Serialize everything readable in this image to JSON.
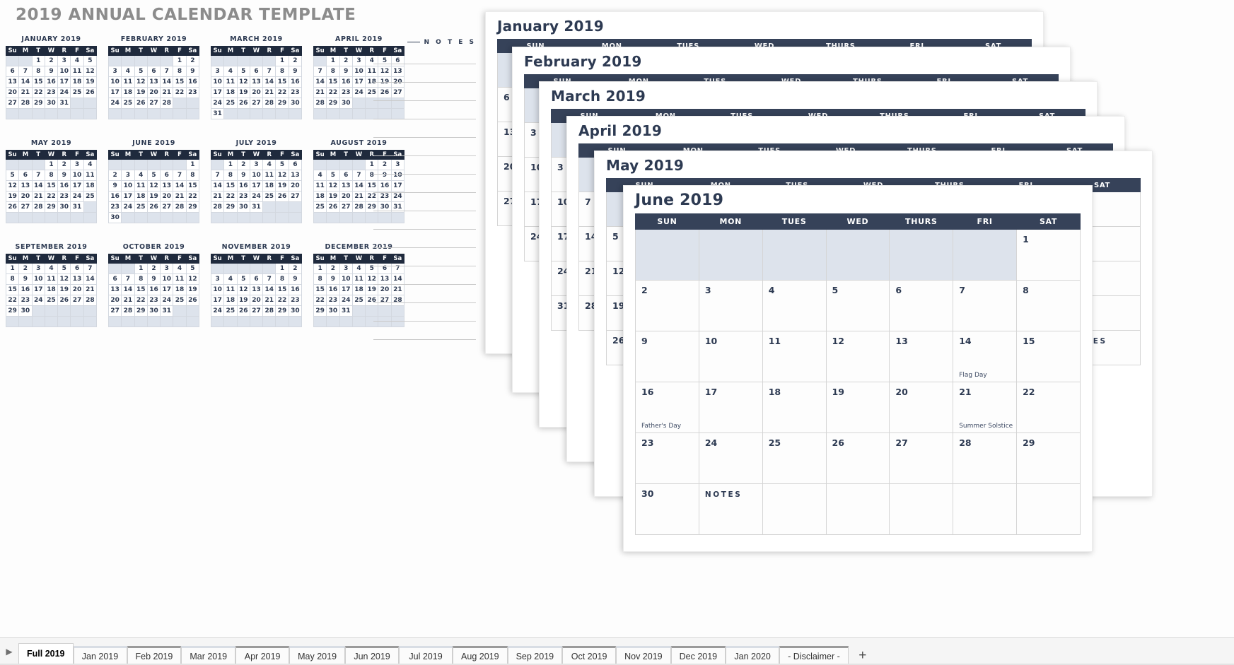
{
  "page_title": "2019 ANNUAL CALENDAR TEMPLATE",
  "notes_left": {
    "heading": "N O T E S",
    "line_count": 16
  },
  "mini_weekday_headers": [
    "Su",
    "M",
    "T",
    "W",
    "R",
    "F",
    "Sa"
  ],
  "mini_months": [
    {
      "title": "JANUARY 2019",
      "lead": 2,
      "days": 31,
      "trail_rows": 1
    },
    {
      "title": "FEBRUARY 2019",
      "lead": 5,
      "days": 28,
      "trail_rows": 1
    },
    {
      "title": "MARCH 2019",
      "lead": 5,
      "days": 31,
      "trail_rows": 0
    },
    {
      "title": "APRIL 2019",
      "lead": 1,
      "days": 30,
      "trail_rows": 1
    },
    {
      "title": "MAY 2019",
      "lead": 3,
      "days": 31,
      "trail_rows": 1
    },
    {
      "title": "JUNE 2019",
      "lead": 6,
      "days": 30,
      "trail_rows": 0
    },
    {
      "title": "JULY 2019",
      "lead": 1,
      "days": 31,
      "trail_rows": 1
    },
    {
      "title": "AUGUST 2019",
      "lead": 4,
      "days": 31,
      "trail_rows": 1
    },
    {
      "title": "SEPTEMBER 2019",
      "lead": 0,
      "days": 30,
      "trail_rows": 1
    },
    {
      "title": "OCTOBER 2019",
      "lead": 2,
      "days": 31,
      "trail_rows": 1
    },
    {
      "title": "NOVEMBER 2019",
      "lead": 5,
      "days": 30,
      "trail_rows": 1
    },
    {
      "title": "DECEMBER 2019",
      "lead": 0,
      "days": 31,
      "trail_rows": 1
    }
  ],
  "big_weekday_headers": [
    "SUN",
    "MON",
    "TUES",
    "WED",
    "THURS",
    "FRI",
    "SAT"
  ],
  "notes_cell_label": "NOTES",
  "cards": [
    {
      "id": "card-jan",
      "title": "January 2019",
      "lead": 2,
      "days": 31
    },
    {
      "id": "card-feb",
      "title": "February 2019",
      "lead": 5,
      "days": 28
    },
    {
      "id": "card-mar",
      "title": "March 2019",
      "lead": 5,
      "days": 31
    },
    {
      "id": "card-apr",
      "title": "April 2019",
      "lead": 1,
      "days": 30
    },
    {
      "id": "card-may",
      "title": "May 2019",
      "lead": 3,
      "days": 31
    },
    {
      "id": "card-jun",
      "title": "June 2019",
      "lead": 6,
      "days": 30
    }
  ],
  "june_events": {
    "14": "Flag Day",
    "16": "Father's Day",
    "21": "Summer Solstice"
  },
  "tabs": [
    {
      "label": "Full 2019",
      "active": true,
      "alt": false
    },
    {
      "label": "Jan 2019",
      "active": false,
      "alt": true
    },
    {
      "label": "Feb 2019",
      "active": false,
      "alt": false
    },
    {
      "label": "Mar 2019",
      "active": false,
      "alt": true
    },
    {
      "label": "Apr 2019",
      "active": false,
      "alt": false
    },
    {
      "label": "May 2019",
      "active": false,
      "alt": true
    },
    {
      "label": "Jun 2019",
      "active": false,
      "alt": false
    },
    {
      "label": "Jul 2019",
      "active": false,
      "alt": true
    },
    {
      "label": "Aug 2019",
      "active": false,
      "alt": false
    },
    {
      "label": "Sep 2019",
      "active": false,
      "alt": true
    },
    {
      "label": "Oct 2019",
      "active": false,
      "alt": false
    },
    {
      "label": "Nov 2019",
      "active": false,
      "alt": true
    },
    {
      "label": "Dec 2019",
      "active": false,
      "alt": false
    },
    {
      "label": "Jan 2020",
      "active": false,
      "alt": true
    },
    {
      "label": "- Disclaimer -",
      "active": false,
      "alt": false
    }
  ],
  "tab_add_label": "+",
  "tab_scroll_label": "▶",
  "colors": {
    "header_navy": "#1f2a3d",
    "big_header_navy": "#364259",
    "lead_cell": "#dde3ec",
    "title_gray": "#8c8c8c",
    "text_navy": "#2d3a52"
  }
}
